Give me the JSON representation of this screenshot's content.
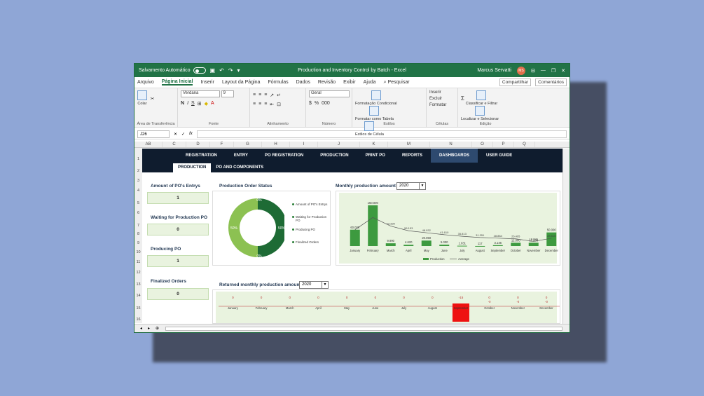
{
  "titlebar": {
    "autosave": "Salvamento Automático",
    "doc_title": "Production and Inventory Control by Batch  -  Excel",
    "user": "Marcus Servatti",
    "avatar": "MS"
  },
  "menu": {
    "items": [
      "Arquivo",
      "Página Inicial",
      "Inserir",
      "Layout da Página",
      "Fórmulas",
      "Dados",
      "Revisão",
      "Exibir",
      "Ajuda",
      "Pesquisar"
    ],
    "share": "Compartilhar",
    "comments": "Comentários"
  },
  "ribbon": {
    "clipboard_label": "Área de Transferência",
    "paste": "Colar",
    "font_name": "Verdana",
    "font_size": "9",
    "font_label": "Fonte",
    "align_label": "Alinhamento",
    "number_format": "Geral",
    "number_label": "Número",
    "cond_format": "Formatação Condicional",
    "format_table": "Formatar como Tabela",
    "cell_styles": "Estilos de Célula",
    "styles_label": "Estilos",
    "insert": "Inserir",
    "delete": "Excluir",
    "format": "Formatar",
    "cells_label": "Células",
    "sort_filter": "Classificar e Filtrar",
    "find_select": "Localizar e Selecionar",
    "edit_label": "Edição"
  },
  "formula": {
    "name_box": "J26",
    "fx": "fx"
  },
  "columns": [
    "AB",
    "C",
    "D",
    "F",
    "G",
    "H",
    "I",
    "J",
    "K",
    "M",
    "N",
    "O",
    "P",
    "Q"
  ],
  "rows": [
    "1",
    "2",
    "3",
    "4",
    "5",
    "6",
    "7",
    "8",
    "9",
    "10",
    "11",
    "12",
    "13",
    "14",
    "15",
    "16"
  ],
  "nav": {
    "tabs": [
      "REGISTRATION",
      "ENTRY",
      "PO REGISTRATION",
      "PRODUCTION",
      "PRINT PO",
      "REPORTS",
      "DASHBOARDS",
      "USER GUIDE"
    ],
    "subtabs": [
      "PRODUCTION",
      "PO AND COMPONENTS"
    ]
  },
  "kpis": [
    {
      "label": "Amount of PO's Entrys",
      "value": "1"
    },
    {
      "label": "Waiting for Production PO",
      "value": "0"
    },
    {
      "label": "Producing PO",
      "value": "1"
    },
    {
      "label": "Finalized Orders",
      "value": "0"
    }
  ],
  "status_panel": {
    "title": "Production Order Status",
    "legend": [
      "Amount of PO's Entrys",
      "Waiting for Production PO",
      "Producing PO",
      "Finalized Orders"
    ]
  },
  "monthly": {
    "title": "Monthly production amount",
    "year": "2020"
  },
  "returned": {
    "title": "Returned monthly production amount",
    "year": "2020"
  },
  "chart_data": [
    {
      "type": "pie",
      "title": "Production Order Status",
      "labels": [
        "Amount of PO's Entrys",
        "Waiting for Production PO",
        "Producing PO",
        "Finalized Orders"
      ],
      "values": [
        50,
        0,
        50,
        0
      ],
      "value_labels": [
        "50%",
        "0%",
        "50%",
        "0%"
      ],
      "colors": [
        "#1e6b35",
        "#2e8f3e",
        "#8cc152",
        "#c8e6a0"
      ]
    },
    {
      "type": "bar",
      "title": "Monthly production amount",
      "categories": [
        "January",
        "February",
        "March",
        "April",
        "May",
        "June",
        "July",
        "August",
        "September",
        "October",
        "November",
        "December"
      ],
      "series": [
        {
          "name": "Production",
          "values": [
            60000,
            150000,
            9990,
            4620,
            20050,
            5000,
            1031,
            117,
            3146,
            12000,
            12000,
            50000
          ]
        },
        {
          "name": "Average",
          "values": [
            60000,
            105000,
            73330,
            56153,
            48932,
            41610,
            35813,
            31351,
            28884,
            26495,
            16996,
            28515
          ]
        }
      ],
      "value_labels": [
        "60.000",
        "150.000",
        "9.990",
        "4.620",
        "20.050",
        "5.000",
        "1.031",
        "117",
        "3.146",
        "12.000",
        "12.000",
        "50.000"
      ],
      "average_labels": [
        "60.000",
        "105.000",
        "73.330",
        "56.153",
        "48.932",
        "41.610",
        "35.813",
        "31.351",
        "28.884",
        "26.495",
        "16.996",
        "28.515"
      ],
      "ylim": [
        0,
        160000
      ]
    },
    {
      "type": "bar",
      "title": "Returned monthly production amount",
      "categories": [
        "January",
        "February",
        "March",
        "April",
        "May",
        "June",
        "July",
        "August",
        "September",
        "October",
        "November",
        "December"
      ],
      "values": [
        0,
        0,
        0,
        0,
        0,
        0,
        0,
        0,
        -15,
        0,
        0,
        0
      ],
      "value_labels": [
        "0",
        "0",
        "0",
        "0",
        "0",
        "0",
        "0",
        "0",
        "-15",
        "0",
        "0",
        "0"
      ],
      "average_labels": [
        "",
        "",
        "",
        "",
        "",
        "",
        "",
        "",
        "",
        "-0",
        "-0",
        "-0"
      ]
    }
  ]
}
